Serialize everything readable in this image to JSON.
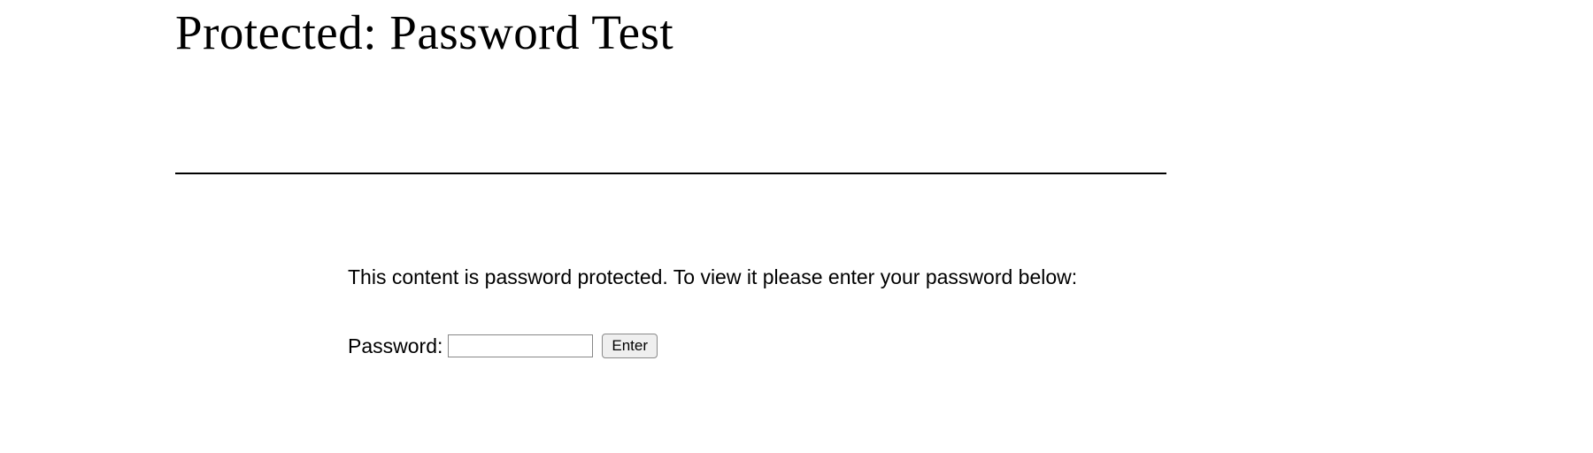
{
  "page": {
    "title": "Protected: Password Test"
  },
  "content": {
    "prompt": "This content is password protected. To view it please enter your password below:",
    "password_label": "Password:",
    "password_value": "",
    "submit_label": "Enter"
  }
}
